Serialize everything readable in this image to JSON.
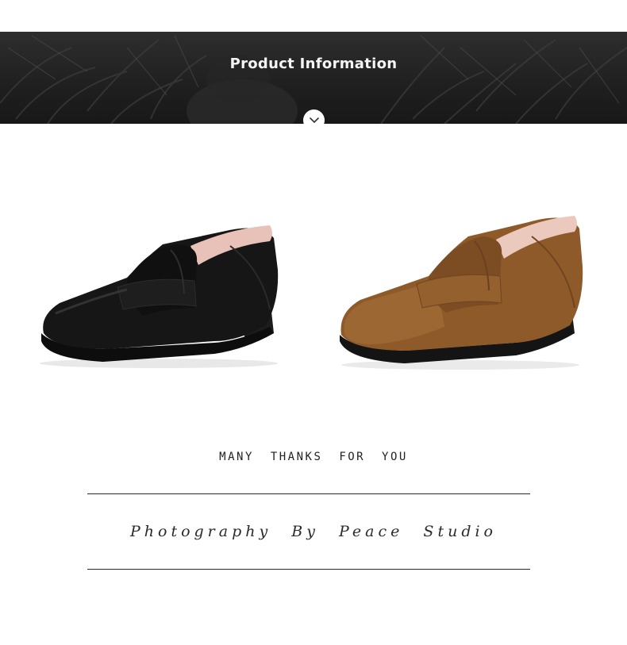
{
  "banner": {
    "title": "Product Information",
    "toggle_icon": "chevron-down-icon"
  },
  "products": [
    {
      "color": "black",
      "hex": "#141414"
    },
    {
      "color": "brown",
      "hex": "#8b5a2b"
    }
  ],
  "footer": {
    "thanks": "MANY THANKS FOR YOU",
    "credit": "Photography By Peace Studio"
  }
}
